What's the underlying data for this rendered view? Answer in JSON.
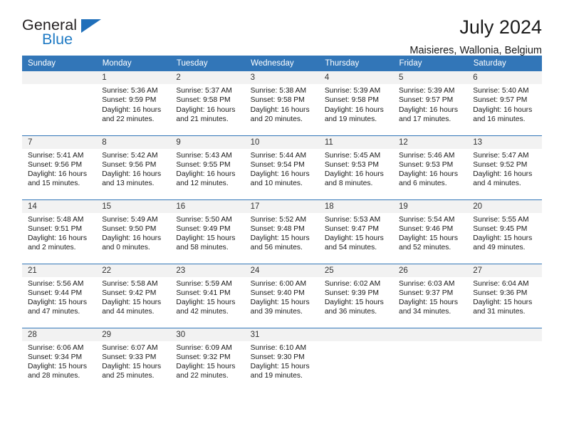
{
  "brand": {
    "name_part1": "General",
    "name_part2": "Blue",
    "accent_color": "#1f7ac4",
    "triangle_color": "#1f6fba"
  },
  "header": {
    "title": "July 2024",
    "subtitle": "Maisieres, Wallonia, Belgium",
    "header_bg": "#3276b8",
    "daynum_bg": "#f2f2f2"
  },
  "weekday_headers": [
    "Sunday",
    "Monday",
    "Tuesday",
    "Wednesday",
    "Thursday",
    "Friday",
    "Saturday"
  ],
  "labels": {
    "sunrise": "Sunrise:",
    "sunset": "Sunset:",
    "daylight": "Daylight:"
  },
  "weeks": [
    [
      {
        "day": "",
        "sunrise": "",
        "sunset": "",
        "daylight_line1": "",
        "daylight_line2": ""
      },
      {
        "day": "1",
        "sunrise": "Sunrise: 5:36 AM",
        "sunset": "Sunset: 9:59 PM",
        "daylight_line1": "Daylight: 16 hours",
        "daylight_line2": "and 22 minutes."
      },
      {
        "day": "2",
        "sunrise": "Sunrise: 5:37 AM",
        "sunset": "Sunset: 9:58 PM",
        "daylight_line1": "Daylight: 16 hours",
        "daylight_line2": "and 21 minutes."
      },
      {
        "day": "3",
        "sunrise": "Sunrise: 5:38 AM",
        "sunset": "Sunset: 9:58 PM",
        "daylight_line1": "Daylight: 16 hours",
        "daylight_line2": "and 20 minutes."
      },
      {
        "day": "4",
        "sunrise": "Sunrise: 5:39 AM",
        "sunset": "Sunset: 9:58 PM",
        "daylight_line1": "Daylight: 16 hours",
        "daylight_line2": "and 19 minutes."
      },
      {
        "day": "5",
        "sunrise": "Sunrise: 5:39 AM",
        "sunset": "Sunset: 9:57 PM",
        "daylight_line1": "Daylight: 16 hours",
        "daylight_line2": "and 17 minutes."
      },
      {
        "day": "6",
        "sunrise": "Sunrise: 5:40 AM",
        "sunset": "Sunset: 9:57 PM",
        "daylight_line1": "Daylight: 16 hours",
        "daylight_line2": "and 16 minutes."
      }
    ],
    [
      {
        "day": "7",
        "sunrise": "Sunrise: 5:41 AM",
        "sunset": "Sunset: 9:56 PM",
        "daylight_line1": "Daylight: 16 hours",
        "daylight_line2": "and 15 minutes."
      },
      {
        "day": "8",
        "sunrise": "Sunrise: 5:42 AM",
        "sunset": "Sunset: 9:56 PM",
        "daylight_line1": "Daylight: 16 hours",
        "daylight_line2": "and 13 minutes."
      },
      {
        "day": "9",
        "sunrise": "Sunrise: 5:43 AM",
        "sunset": "Sunset: 9:55 PM",
        "daylight_line1": "Daylight: 16 hours",
        "daylight_line2": "and 12 minutes."
      },
      {
        "day": "10",
        "sunrise": "Sunrise: 5:44 AM",
        "sunset": "Sunset: 9:54 PM",
        "daylight_line1": "Daylight: 16 hours",
        "daylight_line2": "and 10 minutes."
      },
      {
        "day": "11",
        "sunrise": "Sunrise: 5:45 AM",
        "sunset": "Sunset: 9:53 PM",
        "daylight_line1": "Daylight: 16 hours",
        "daylight_line2": "and 8 minutes."
      },
      {
        "day": "12",
        "sunrise": "Sunrise: 5:46 AM",
        "sunset": "Sunset: 9:53 PM",
        "daylight_line1": "Daylight: 16 hours",
        "daylight_line2": "and 6 minutes."
      },
      {
        "day": "13",
        "sunrise": "Sunrise: 5:47 AM",
        "sunset": "Sunset: 9:52 PM",
        "daylight_line1": "Daylight: 16 hours",
        "daylight_line2": "and 4 minutes."
      }
    ],
    [
      {
        "day": "14",
        "sunrise": "Sunrise: 5:48 AM",
        "sunset": "Sunset: 9:51 PM",
        "daylight_line1": "Daylight: 16 hours",
        "daylight_line2": "and 2 minutes."
      },
      {
        "day": "15",
        "sunrise": "Sunrise: 5:49 AM",
        "sunset": "Sunset: 9:50 PM",
        "daylight_line1": "Daylight: 16 hours",
        "daylight_line2": "and 0 minutes."
      },
      {
        "day": "16",
        "sunrise": "Sunrise: 5:50 AM",
        "sunset": "Sunset: 9:49 PM",
        "daylight_line1": "Daylight: 15 hours",
        "daylight_line2": "and 58 minutes."
      },
      {
        "day": "17",
        "sunrise": "Sunrise: 5:52 AM",
        "sunset": "Sunset: 9:48 PM",
        "daylight_line1": "Daylight: 15 hours",
        "daylight_line2": "and 56 minutes."
      },
      {
        "day": "18",
        "sunrise": "Sunrise: 5:53 AM",
        "sunset": "Sunset: 9:47 PM",
        "daylight_line1": "Daylight: 15 hours",
        "daylight_line2": "and 54 minutes."
      },
      {
        "day": "19",
        "sunrise": "Sunrise: 5:54 AM",
        "sunset": "Sunset: 9:46 PM",
        "daylight_line1": "Daylight: 15 hours",
        "daylight_line2": "and 52 minutes."
      },
      {
        "day": "20",
        "sunrise": "Sunrise: 5:55 AM",
        "sunset": "Sunset: 9:45 PM",
        "daylight_line1": "Daylight: 15 hours",
        "daylight_line2": "and 49 minutes."
      }
    ],
    [
      {
        "day": "21",
        "sunrise": "Sunrise: 5:56 AM",
        "sunset": "Sunset: 9:44 PM",
        "daylight_line1": "Daylight: 15 hours",
        "daylight_line2": "and 47 minutes."
      },
      {
        "day": "22",
        "sunrise": "Sunrise: 5:58 AM",
        "sunset": "Sunset: 9:42 PM",
        "daylight_line1": "Daylight: 15 hours",
        "daylight_line2": "and 44 minutes."
      },
      {
        "day": "23",
        "sunrise": "Sunrise: 5:59 AM",
        "sunset": "Sunset: 9:41 PM",
        "daylight_line1": "Daylight: 15 hours",
        "daylight_line2": "and 42 minutes."
      },
      {
        "day": "24",
        "sunrise": "Sunrise: 6:00 AM",
        "sunset": "Sunset: 9:40 PM",
        "daylight_line1": "Daylight: 15 hours",
        "daylight_line2": "and 39 minutes."
      },
      {
        "day": "25",
        "sunrise": "Sunrise: 6:02 AM",
        "sunset": "Sunset: 9:39 PM",
        "daylight_line1": "Daylight: 15 hours",
        "daylight_line2": "and 36 minutes."
      },
      {
        "day": "26",
        "sunrise": "Sunrise: 6:03 AM",
        "sunset": "Sunset: 9:37 PM",
        "daylight_line1": "Daylight: 15 hours",
        "daylight_line2": "and 34 minutes."
      },
      {
        "day": "27",
        "sunrise": "Sunrise: 6:04 AM",
        "sunset": "Sunset: 9:36 PM",
        "daylight_line1": "Daylight: 15 hours",
        "daylight_line2": "and 31 minutes."
      }
    ],
    [
      {
        "day": "28",
        "sunrise": "Sunrise: 6:06 AM",
        "sunset": "Sunset: 9:34 PM",
        "daylight_line1": "Daylight: 15 hours",
        "daylight_line2": "and 28 minutes."
      },
      {
        "day": "29",
        "sunrise": "Sunrise: 6:07 AM",
        "sunset": "Sunset: 9:33 PM",
        "daylight_line1": "Daylight: 15 hours",
        "daylight_line2": "and 25 minutes."
      },
      {
        "day": "30",
        "sunrise": "Sunrise: 6:09 AM",
        "sunset": "Sunset: 9:32 PM",
        "daylight_line1": "Daylight: 15 hours",
        "daylight_line2": "and 22 minutes."
      },
      {
        "day": "31",
        "sunrise": "Sunrise: 6:10 AM",
        "sunset": "Sunset: 9:30 PM",
        "daylight_line1": "Daylight: 15 hours",
        "daylight_line2": "and 19 minutes."
      },
      {
        "day": "",
        "sunrise": "",
        "sunset": "",
        "daylight_line1": "",
        "daylight_line2": ""
      },
      {
        "day": "",
        "sunrise": "",
        "sunset": "",
        "daylight_line1": "",
        "daylight_line2": ""
      },
      {
        "day": "",
        "sunrise": "",
        "sunset": "",
        "daylight_line1": "",
        "daylight_line2": ""
      }
    ]
  ]
}
